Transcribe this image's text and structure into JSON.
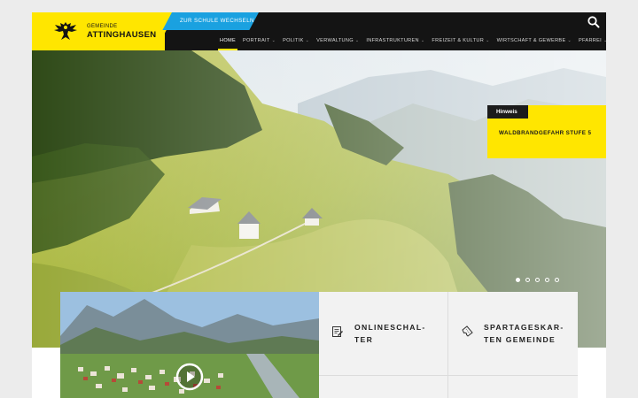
{
  "header": {
    "logo_small": "GEMEINDE",
    "logo_big": "ATTINGHAUSEN",
    "school_tab": "ZUR SCHULE WECHSELN",
    "search_icon": "search-icon"
  },
  "nav": {
    "items": [
      {
        "label": "HOME",
        "has_sub": false
      },
      {
        "label": "PORTRAIT",
        "has_sub": true
      },
      {
        "label": "POLITIK",
        "has_sub": true
      },
      {
        "label": "VERWALTUNG",
        "has_sub": true
      },
      {
        "label": "INFRASTRUKTUREN",
        "has_sub": true
      },
      {
        "label": "FREIZEIT & KULTUR",
        "has_sub": true
      },
      {
        "label": "WIRTSCHAFT & GEWERBE",
        "has_sub": true
      },
      {
        "label": "PFARREI",
        "has_sub": true
      }
    ],
    "active_index": 0,
    "chevron": "⌄"
  },
  "hero": {
    "notice_tag": "Hinweis",
    "notice_text": "WALDBRANDGEFAHR STUFE 5",
    "slide_count": 5,
    "active_slide": 0
  },
  "tiles": [
    {
      "line1": "ONLINESCHAL-",
      "line2": "TER",
      "icon": "document-edit-icon"
    },
    {
      "line1": "SPARTAGESKAR-",
      "line2": "TEN GEMEINDE",
      "icon": "ticket-icon"
    }
  ],
  "video": {
    "icon": "play-icon"
  },
  "colors": {
    "accent": "#ffe600",
    "school_tab": "#1aa1e0",
    "header": "#141414"
  }
}
